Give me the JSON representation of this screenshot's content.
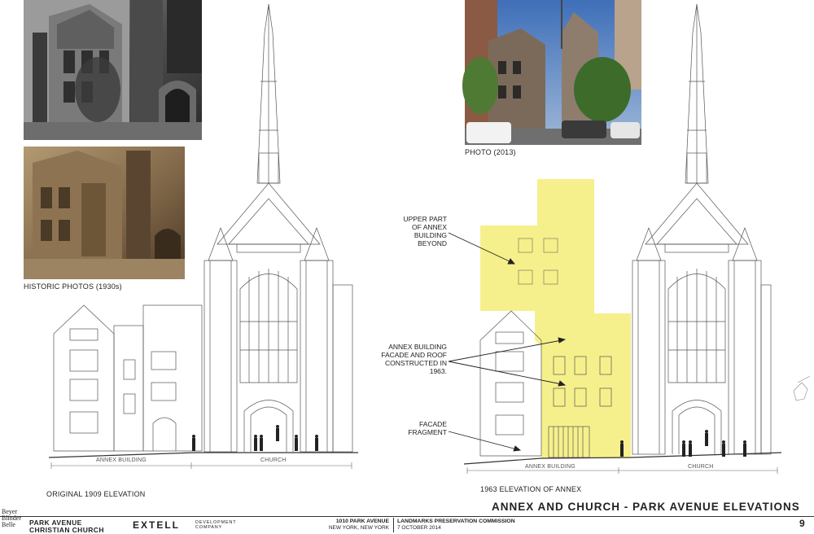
{
  "captions": {
    "historic_photos": "HISTORIC PHOTOS (1930s)",
    "photo_2013": "PHOTO (2013)",
    "original_elevation": "ORIGINAL 1909 ELEVATION",
    "elevation_1963": "1963 ELEVATION OF ANNEX"
  },
  "left_drawing": {
    "annex_label": "ANNEX BUILDING",
    "church_label": "CHURCH"
  },
  "right_drawing": {
    "annex_label": "ANNEX BUILDING",
    "church_label": "CHURCH"
  },
  "notes": {
    "upper": [
      "UPPER PART",
      "OF ANNEX",
      "BUILDING",
      "BEYOND"
    ],
    "annex": [
      "ANNEX BUILDING",
      "FACADE AND ROOF",
      "CONSTRUCTED IN",
      "1963."
    ],
    "fragment": [
      "FACADE",
      "FRAGMENT"
    ]
  },
  "footer": {
    "title": "ANNEX AND CHURCH - PARK AVENUE ELEVATIONS",
    "page_number": "9",
    "architect_logo": [
      "Beyer",
      "Blinder",
      "Belle"
    ],
    "client": [
      "PARK AVENUE",
      "CHRISTIAN CHURCH"
    ],
    "developer": "EXTELL",
    "developer_sub": [
      "DEVELOPMENT",
      "COMPANY"
    ],
    "address": [
      "1010 PARK AVENUE",
      "NEW YORK, NEW YORK"
    ],
    "commission": [
      "LANDMARKS PRESERVATION COMMISSION",
      "7 OCTOBER 2014"
    ]
  },
  "colors": {
    "highlight": "#f6f08c",
    "line": "#555555",
    "sepia_dark": "#5b4a33",
    "sepia_light": "#b39a72"
  }
}
